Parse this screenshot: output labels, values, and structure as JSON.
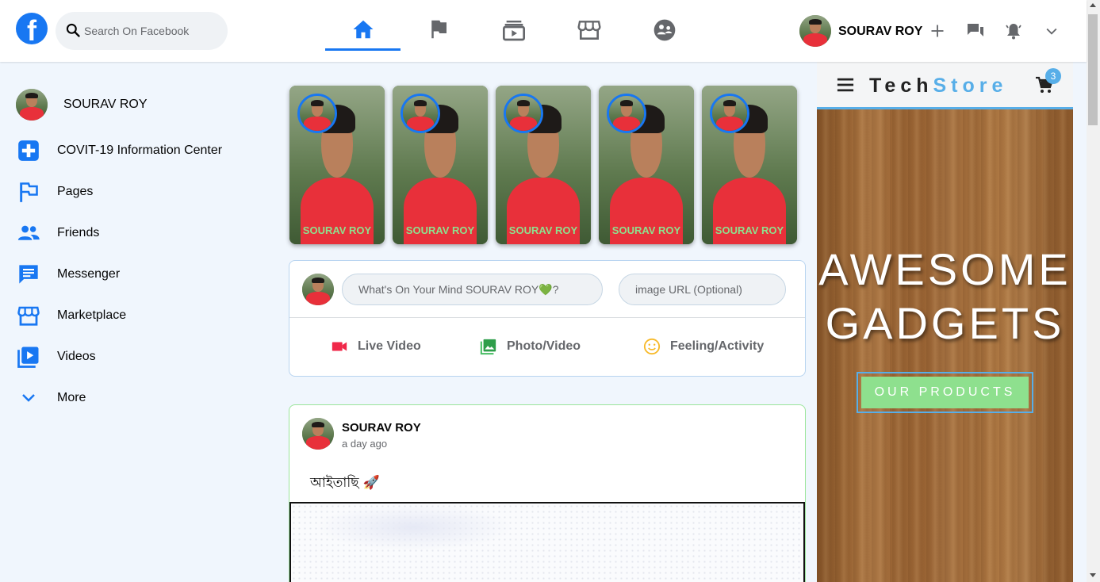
{
  "header": {
    "search_placeholder": "Search On Facebook",
    "nav_tabs": [
      {
        "name": "home",
        "active": true
      },
      {
        "name": "pages"
      },
      {
        "name": "watch"
      },
      {
        "name": "marketplace"
      },
      {
        "name": "groups"
      }
    ],
    "user_name": "SOURAV ROY"
  },
  "sidebar": {
    "profile_name": "SOURAV ROY",
    "items": [
      {
        "label": "COVIT-19 Information Center",
        "icon": "plus-square-icon"
      },
      {
        "label": "Pages",
        "icon": "flag-icon"
      },
      {
        "label": "Friends",
        "icon": "people-icon"
      },
      {
        "label": "Messenger",
        "icon": "chat-icon"
      },
      {
        "label": "Marketplace",
        "icon": "store-icon"
      },
      {
        "label": "Videos",
        "icon": "video-library-icon"
      },
      {
        "label": "More",
        "icon": "chevron-down-icon"
      }
    ]
  },
  "stories": [
    {
      "name": "SOURAV ROY"
    },
    {
      "name": "SOURAV ROY"
    },
    {
      "name": "SOURAV ROY"
    },
    {
      "name": "SOURAV ROY"
    },
    {
      "name": "SOURAV ROY"
    }
  ],
  "composer": {
    "mind_placeholder": "What's On Your Mind SOURAV ROY💚?",
    "url_placeholder": "image URL (Optional)",
    "actions": {
      "live": "Live Video",
      "photo": "Photo/Video",
      "feeling": "Feeling/Activity"
    }
  },
  "post": {
    "author": "SOURAV ROY",
    "time": "a day ago",
    "text": "আইতাছি 🚀"
  },
  "store": {
    "brand_part1": "Tech",
    "brand_part2": "Store",
    "cart_count": "3",
    "hero_line1": "AWESOME",
    "hero_line2": "GADGETS",
    "button": "OUR PRODUCTS"
  },
  "colors": {
    "accent": "#1877f2",
    "store_accent": "#57aee8",
    "story_name": "#8ee08e",
    "button_green": "#8ee08e"
  }
}
